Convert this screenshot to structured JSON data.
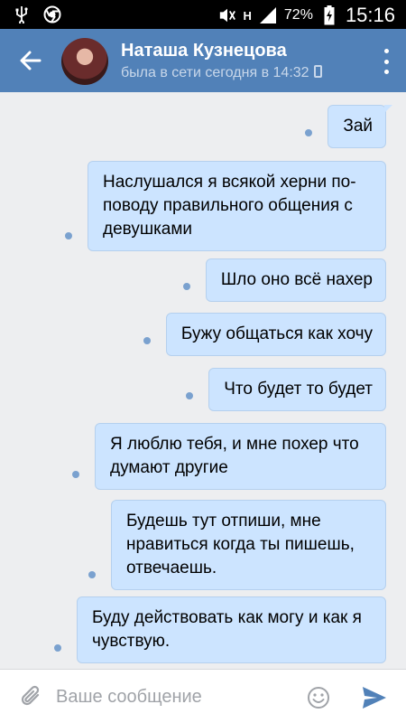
{
  "status_bar": {
    "battery": "72%",
    "time": "15:16",
    "network": "H"
  },
  "header": {
    "name": "Наташа Кузнецова",
    "status": "была в сети сегодня в 14:32"
  },
  "messages": [
    "Зай",
    "Наслушался я всякой херни по-поводу правильного общения с девушками",
    "Шло оно всё нахер",
    "Бужу общаться как хочу",
    "Что будет то будет",
    "Я люблю тебя, и мне похер что думают другие",
    "Будешь тут отпиши, мне нравиться когда ты пишешь, отвечаешь.",
    "Буду действовать как могу и как я чувствую."
  ],
  "input": {
    "placeholder": "Ваше сообщение"
  },
  "colors": {
    "header_bg": "#5181b8",
    "bubble_bg": "#cce4ff",
    "chat_bg": "#edeef0",
    "send_icon": "#5181b8"
  },
  "icons": [
    "usb-icon",
    "chrome-icon",
    "mute-icon",
    "signal-icon",
    "battery-icon",
    "back-arrow-icon",
    "phone-icon",
    "more-vertical-icon",
    "paperclip-icon",
    "emoji-icon",
    "send-icon"
  ]
}
